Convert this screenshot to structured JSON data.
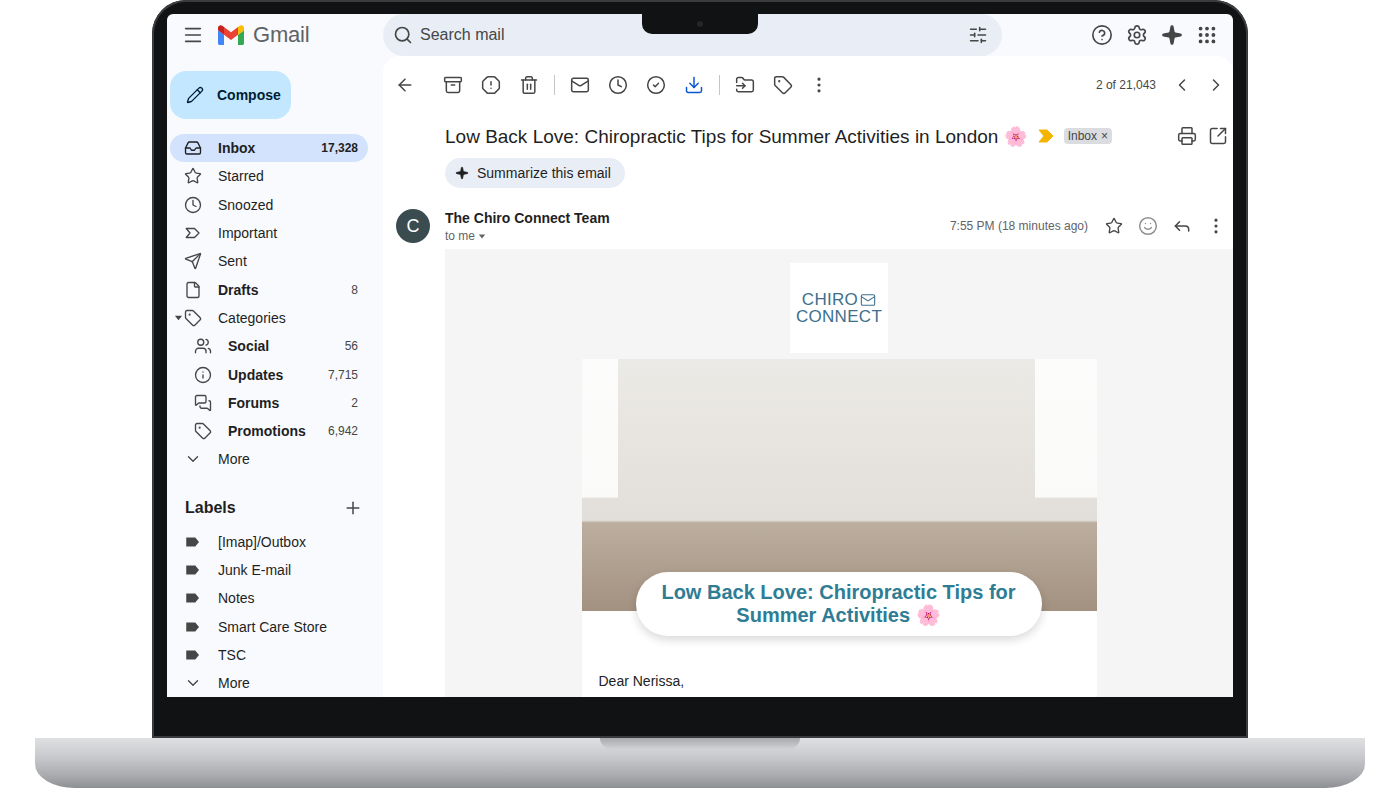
{
  "app": {
    "name": "Gmail"
  },
  "search": {
    "placeholder": "Search mail"
  },
  "compose": {
    "label": "Compose"
  },
  "nav": [
    {
      "label": "Inbox",
      "count": "17,328",
      "kind": "item",
      "selected": true,
      "bold": true
    },
    {
      "label": "Starred",
      "kind": "item",
      "selected": false,
      "bold": false
    },
    {
      "label": "Snoozed",
      "kind": "item",
      "selected": false,
      "bold": false
    },
    {
      "label": "Important",
      "kind": "item",
      "selected": false,
      "bold": false
    },
    {
      "label": "Sent",
      "kind": "item",
      "selected": false,
      "bold": false
    },
    {
      "label": "Drafts",
      "count": "8",
      "kind": "item",
      "selected": false,
      "bold": true
    },
    {
      "label": "Categories",
      "kind": "group",
      "selected": false,
      "bold": false,
      "expanded": true
    },
    {
      "label": "Social",
      "count": "56",
      "kind": "sub",
      "selected": false,
      "bold": true
    },
    {
      "label": "Updates",
      "count": "7,715",
      "kind": "sub",
      "selected": false,
      "bold": true
    },
    {
      "label": "Forums",
      "count": "2",
      "kind": "sub",
      "selected": false,
      "bold": true
    },
    {
      "label": "Promotions",
      "count": "6,942",
      "kind": "sub",
      "selected": false,
      "bold": true
    },
    {
      "label": "More",
      "kind": "more",
      "selected": false,
      "bold": false
    }
  ],
  "labels": {
    "title": "Labels",
    "items": [
      {
        "label": "[Imap]/Outbox",
        "kind": "label"
      },
      {
        "label": "Junk E-mail",
        "kind": "label"
      },
      {
        "label": "Notes",
        "kind": "label"
      },
      {
        "label": "Smart Care Store",
        "kind": "label"
      },
      {
        "label": "TSC",
        "kind": "label"
      },
      {
        "label": "More",
        "kind": "more"
      }
    ]
  },
  "toolbar": {
    "position": "2 of 21,043"
  },
  "message": {
    "subject": "Low Back Love: Chiropractic Tips for Summer Activities in London 🌸",
    "important": true,
    "chip": {
      "label": "Inbox",
      "close": "×"
    },
    "summarize": "Summarize this email",
    "sender": {
      "name": "The Chiro Connect Team",
      "initial": "C",
      "recipient": "to me"
    },
    "time": "7:55 PM (18 minutes ago)",
    "starred": false,
    "body": {
      "logo": {
        "top": "CHIRO",
        "bottom": "CONNECT"
      },
      "banner": "Low Back Love: Chiropractic Tips for Summer Activities 🌸",
      "greeting": "Dear Nerissa,"
    }
  }
}
